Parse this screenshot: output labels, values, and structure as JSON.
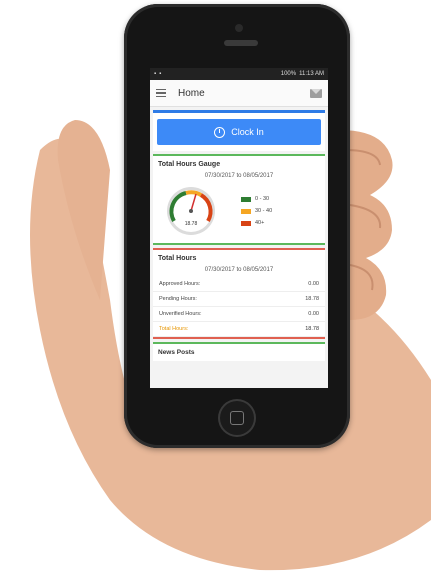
{
  "status_bar": {
    "time": "11:13 AM",
    "battery": "100%"
  },
  "app_bar": {
    "title": "Home"
  },
  "clock_in": {
    "label": "Clock In"
  },
  "gauge_card": {
    "title": "Total Hours Gauge",
    "date_range": "07/30/2017 to 08/05/2017",
    "gauge_value": "18.78",
    "legend": [
      {
        "label": "0 - 30",
        "color": "#2e7d32"
      },
      {
        "label": "30 - 40",
        "color": "#f5a623"
      },
      {
        "label": "40+",
        "color": "#d84315"
      }
    ]
  },
  "hours_card": {
    "title": "Total Hours",
    "date_range": "07/30/2017 to 08/05/2017",
    "rows": [
      {
        "label": "Approved Hours:",
        "value": "0.00"
      },
      {
        "label": "Pending Hours:",
        "value": "18.78"
      },
      {
        "label": "Unverified Hours:",
        "value": "0.00"
      },
      {
        "label": "Total Hours:",
        "value": "18.78"
      }
    ]
  },
  "news_card": {
    "title": "News Posts"
  },
  "colors": {
    "accent": "#3d8af7",
    "green": "#5cb85c",
    "red": "#e06050",
    "total": "#e69500"
  }
}
